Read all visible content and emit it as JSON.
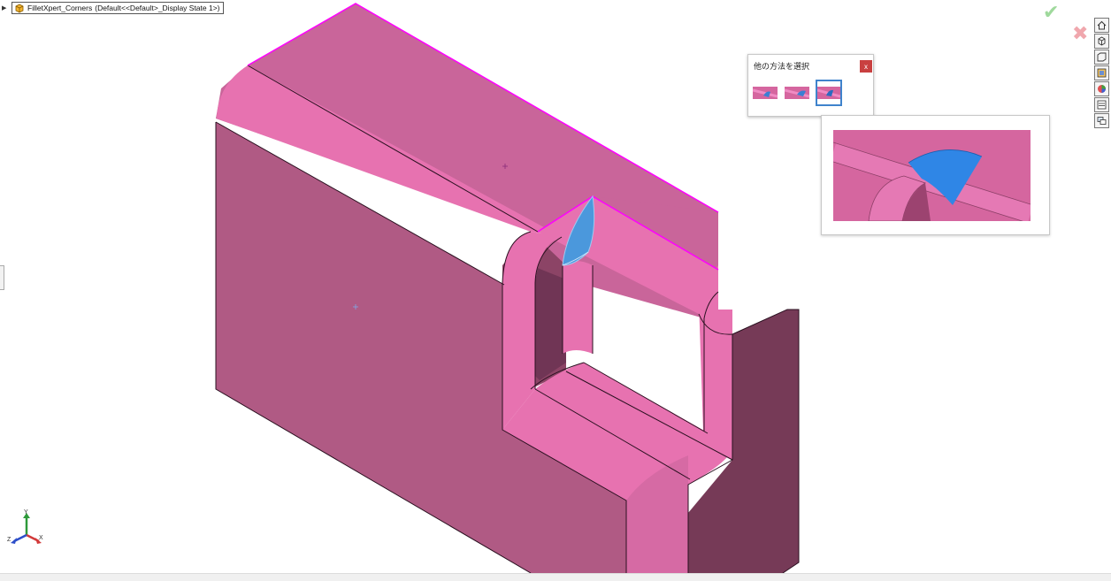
{
  "document": {
    "title": "FilletXpert_Corners",
    "configuration": "(Default<<Default>_Display State 1>)",
    "part_icon": "part-icon"
  },
  "confirm_corner": {
    "accept_icon": "check-icon",
    "cancel_icon": "close-icon"
  },
  "popup": {
    "title": "他の方法を選択",
    "close_label": "x",
    "options": [
      {
        "name": "corner-option-1"
      },
      {
        "name": "corner-option-2"
      },
      {
        "name": "corner-option-3",
        "selected": true
      }
    ]
  },
  "heads_up_toolbar": [
    "home-view-icon",
    "view-orientation-icon",
    "section-view-icon",
    "display-style-icon",
    "appearance-icon",
    "scene-icon",
    "display-pane-icon"
  ],
  "colors": {
    "model_top": "#c9659a",
    "model_face": "#b05a84",
    "model_fillet": "#e772b0",
    "model_shadow": "#763a57",
    "selection_edge": "#ff00ff",
    "selected_corner": "#4b98dc",
    "highlight": "#3f83cc"
  },
  "triad": {
    "x_label": "X",
    "y_label": "Y",
    "z_label": "Z"
  }
}
